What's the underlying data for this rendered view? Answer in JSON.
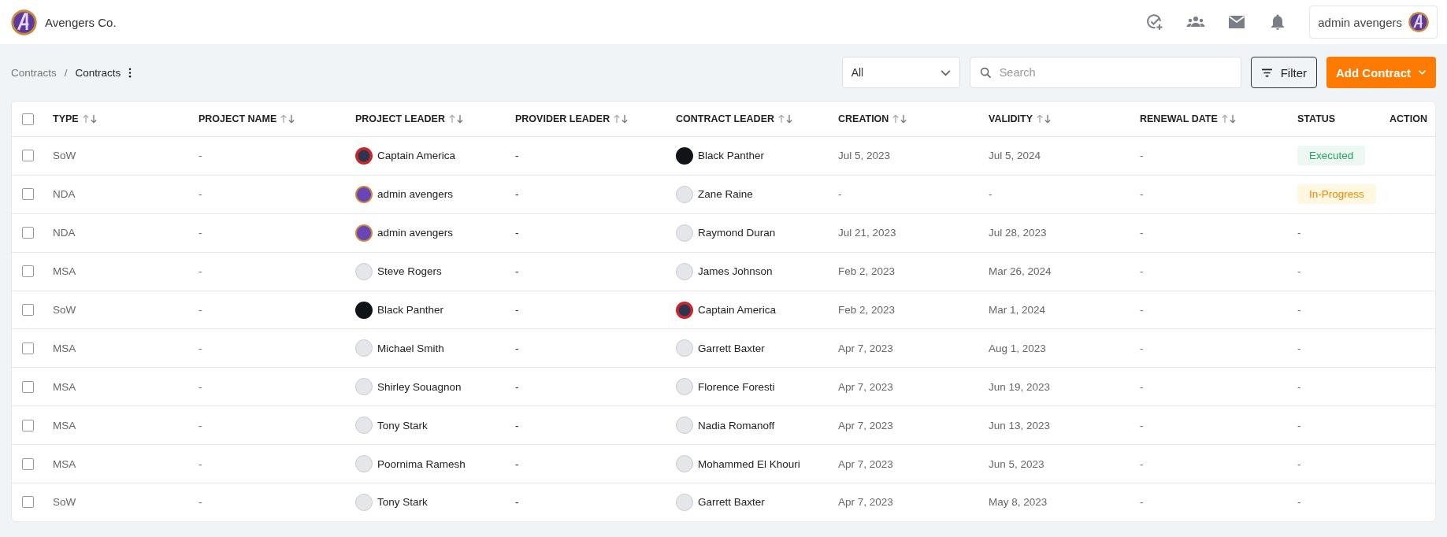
{
  "topbar": {
    "company": "Avengers Co.",
    "user": "admin avengers"
  },
  "breadcrumb": {
    "parent": "Contracts",
    "separator": "/",
    "current": "Contracts"
  },
  "toolbar": {
    "select_value": "All",
    "search_placeholder": "Search",
    "filter_label": "Filter",
    "add_label": "Add Contract"
  },
  "table": {
    "select_all_checked": false,
    "columns": [
      {
        "label": "TYPE",
        "sortable": true
      },
      {
        "label": "PROJECT NAME",
        "sortable": true
      },
      {
        "label": "PROJECT LEADER",
        "sortable": true
      },
      {
        "label": "PROVIDER LEADER",
        "sortable": true
      },
      {
        "label": "CONTRACT LEADER",
        "sortable": true
      },
      {
        "label": "CREATION",
        "sortable": true
      },
      {
        "label": "VALIDITY",
        "sortable": true
      },
      {
        "label": "RENEWAL DATE",
        "sortable": true
      },
      {
        "label": "STATUS",
        "sortable": false
      },
      {
        "label": "ACTION",
        "sortable": false
      }
    ],
    "rows": [
      {
        "checked": false,
        "type": "SoW",
        "project_name": "-",
        "project_leader": {
          "name": "Captain America",
          "kind": "shield"
        },
        "provider_leader": "-",
        "contract_leader": {
          "name": "Black Panther",
          "kind": "dark"
        },
        "creation": "Jul 5, 2023",
        "validity": "Jul 5, 2024",
        "renewal_date": "-",
        "status": {
          "text": "Executed",
          "kind": "executed"
        }
      },
      {
        "checked": false,
        "type": "NDA",
        "project_name": "-",
        "project_leader": {
          "name": "admin avengers",
          "kind": "logo"
        },
        "provider_leader": "-",
        "contract_leader": {
          "name": "Zane Raine",
          "kind": "blank"
        },
        "creation": "-",
        "validity": "-",
        "renewal_date": "-",
        "status": {
          "text": "In-Progress",
          "kind": "in-progress"
        }
      },
      {
        "checked": false,
        "type": "NDA",
        "project_name": "-",
        "project_leader": {
          "name": "admin avengers",
          "kind": "logo"
        },
        "provider_leader": "-",
        "contract_leader": {
          "name": "Raymond Duran",
          "kind": "blank"
        },
        "creation": "Jul 21, 2023",
        "validity": "Jul 28, 2023",
        "renewal_date": "-",
        "status": {
          "text": "-",
          "kind": "plain"
        }
      },
      {
        "checked": false,
        "type": "MSA",
        "project_name": "-",
        "project_leader": {
          "name": "Steve Rogers",
          "kind": "blank"
        },
        "provider_leader": "-",
        "contract_leader": {
          "name": "James Johnson",
          "kind": "blank"
        },
        "creation": "Feb 2, 2023",
        "validity": "Mar 26, 2024",
        "renewal_date": "-",
        "status": {
          "text": "-",
          "kind": "plain"
        }
      },
      {
        "checked": false,
        "type": "SoW",
        "project_name": "-",
        "project_leader": {
          "name": "Black Panther",
          "kind": "dark"
        },
        "provider_leader": "-",
        "contract_leader": {
          "name": "Captain America",
          "kind": "shield"
        },
        "creation": "Feb 2, 2023",
        "validity": "Mar 1, 2024",
        "renewal_date": "-",
        "status": {
          "text": "-",
          "kind": "plain"
        }
      },
      {
        "checked": false,
        "type": "MSA",
        "project_name": "-",
        "project_leader": {
          "name": "Michael Smith",
          "kind": "blank"
        },
        "provider_leader": "-",
        "contract_leader": {
          "name": "Garrett Baxter",
          "kind": "blank"
        },
        "creation": "Apr 7, 2023",
        "validity": "Aug 1, 2023",
        "renewal_date": "-",
        "status": {
          "text": "-",
          "kind": "plain"
        }
      },
      {
        "checked": false,
        "type": "MSA",
        "project_name": "-",
        "project_leader": {
          "name": "Shirley Souagnon",
          "kind": "blank"
        },
        "provider_leader": "-",
        "contract_leader": {
          "name": "Florence Foresti",
          "kind": "blank"
        },
        "creation": "Apr 7, 2023",
        "validity": "Jun 19, 2023",
        "renewal_date": "-",
        "status": {
          "text": "-",
          "kind": "plain"
        }
      },
      {
        "checked": false,
        "type": "MSA",
        "project_name": "-",
        "project_leader": {
          "name": "Tony Stark",
          "kind": "blank"
        },
        "provider_leader": "-",
        "contract_leader": {
          "name": "Nadia Romanoff",
          "kind": "blank"
        },
        "creation": "Apr 7, 2023",
        "validity": "Jun 13, 2023",
        "renewal_date": "-",
        "status": {
          "text": "-",
          "kind": "plain"
        }
      },
      {
        "checked": false,
        "type": "MSA",
        "project_name": "-",
        "project_leader": {
          "name": "Poornima Ramesh",
          "kind": "blank"
        },
        "provider_leader": "-",
        "contract_leader": {
          "name": "Mohammed El Khouri",
          "kind": "blank"
        },
        "creation": "Apr 7, 2023",
        "validity": "Jun 5, 2023",
        "renewal_date": "-",
        "status": {
          "text": "-",
          "kind": "plain"
        }
      },
      {
        "checked": false,
        "type": "SoW",
        "project_name": "-",
        "project_leader": {
          "name": "Tony Stark",
          "kind": "blank"
        },
        "provider_leader": "-",
        "contract_leader": {
          "name": "Garrett Baxter",
          "kind": "blank"
        },
        "creation": "Apr 7, 2023",
        "validity": "May 8, 2023",
        "renewal_date": "-",
        "status": {
          "text": "-",
          "kind": "plain"
        }
      }
    ]
  }
}
